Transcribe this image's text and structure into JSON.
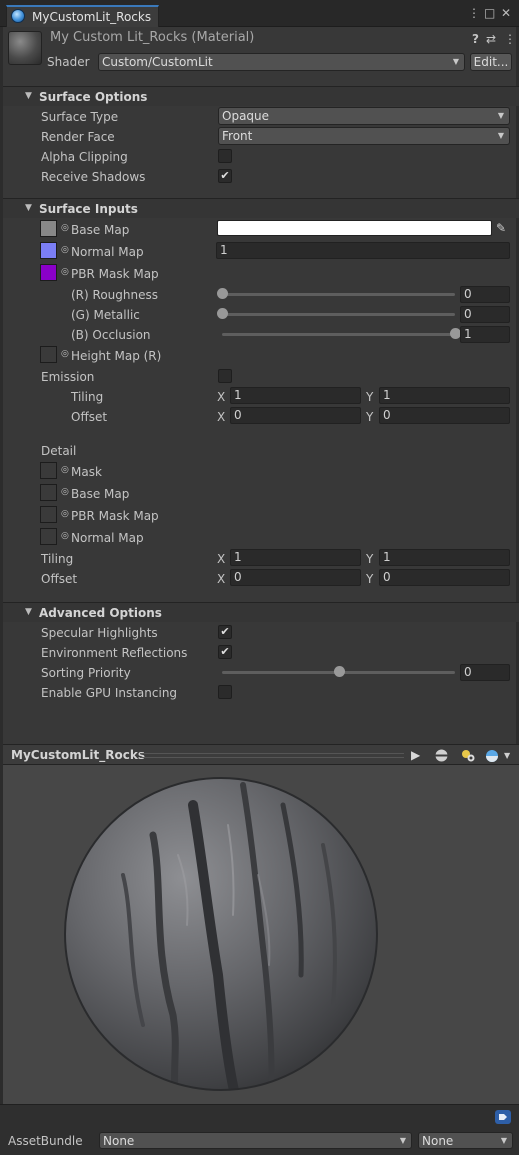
{
  "window": {
    "tab_title": "MyCustomLit_Rocks",
    "tab_icon": "material-sphere-icon",
    "menu_icon": "⋮",
    "maximize_icon": "□",
    "close_icon": "✕"
  },
  "header": {
    "material_name": "My Custom Lit_Rocks (Material)",
    "help_icon": "?",
    "settings_icon": "⇄",
    "more_icon": "⋮",
    "shader_label": "Shader",
    "shader_value": "Custom/CustomLit",
    "edit_button": "Edit..."
  },
  "surface_options": {
    "title": "Surface Options",
    "surface_type_label": "Surface Type",
    "surface_type_value": "Opaque",
    "render_face_label": "Render Face",
    "render_face_value": "Front",
    "alpha_clipping_label": "Alpha Clipping",
    "alpha_clipping_checked": false,
    "receive_shadows_label": "Receive Shadows",
    "receive_shadows_checked": true
  },
  "surface_inputs": {
    "title": "Surface Inputs",
    "base_map_label": "Base Map",
    "base_map_color": "#ffffff",
    "base_map_swatch": "#888888",
    "normal_map_label": "Normal Map",
    "normal_map_value": "1",
    "normal_map_swatch": "#7b7ef5",
    "pbr_mask_label": "PBR Mask Map",
    "pbr_mask_swatch": "#8a00c8",
    "roughness_label": "(R) Roughness",
    "roughness_value": "0",
    "roughness_fraction": 0,
    "metallic_label": "(G) Metallic",
    "metallic_value": "0",
    "metallic_fraction": 0,
    "occlusion_label": "(B) Occlusion",
    "occlusion_value": "1",
    "occlusion_fraction": 1,
    "height_map_label": "Height Map (R)",
    "emission_label": "Emission",
    "emission_checked": false,
    "tiling_label": "Tiling",
    "tiling_x": "1",
    "tiling_y": "1",
    "offset_label": "Offset",
    "offset_x": "0",
    "offset_y": "0",
    "x_label": "X",
    "y_label": "Y"
  },
  "detail": {
    "title": "Detail",
    "mask_label": "Mask",
    "base_map_label": "Base Map",
    "pbr_mask_label": "PBR Mask Map",
    "normal_map_label": "Normal Map",
    "tiling_label": "Tiling",
    "tiling_x": "1",
    "tiling_y": "1",
    "offset_label": "Offset",
    "offset_x": "0",
    "offset_y": "0",
    "x_label": "X",
    "y_label": "Y"
  },
  "advanced_options": {
    "title": "Advanced Options",
    "specular_label": "Specular Highlights",
    "specular_checked": true,
    "env_reflections_label": "Environment Reflections",
    "env_reflections_checked": true,
    "sorting_priority_label": "Sorting Priority",
    "sorting_priority_value": "0",
    "sorting_priority_fraction": 0.5,
    "gpu_instancing_label": "Enable GPU Instancing",
    "gpu_instancing_checked": false
  },
  "preview": {
    "title": "MyCustomLit_Rocks",
    "play_icon": "▶",
    "tag_icon": "tag-icon"
  },
  "asset_bundle": {
    "label": "AssetBundle",
    "name_value": "None",
    "variant_value": "None"
  }
}
